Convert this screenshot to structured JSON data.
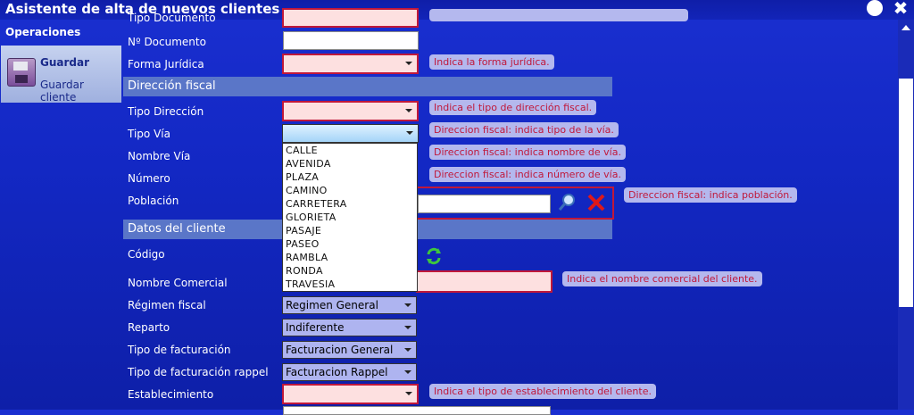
{
  "window": {
    "title": "Asistente de alta de nuevos clientes"
  },
  "left_panel": {
    "heading": "Operaciones",
    "save": {
      "title": "Guardar",
      "subtitle": "Guardar cliente"
    }
  },
  "form": {
    "labels": {
      "tipo_documento": "Tipo Documento",
      "n_documento": "Nº Documento",
      "forma_juridica": "Forma Jurídica",
      "tipo_direccion": "Tipo Dirección",
      "tipo_via": "Tipo Vía",
      "nombre_via": "Nombre Vía",
      "numero": "Número",
      "poblacion": "Población",
      "codigo": "Código",
      "nombre_comercial": "Nombre Comercial",
      "regimen_fiscal": "Régimen fiscal",
      "reparto": "Reparto",
      "tipo_facturacion": "Tipo de facturación",
      "tipo_facturacion_rappel": "Tipo de facturación rappel",
      "establecimiento": "Establecimiento"
    },
    "sections": {
      "direccion_fiscal": "Dirección fiscal",
      "datos_cliente": "Datos del cliente"
    },
    "selects": {
      "regimen_fiscal": "Regimen General",
      "reparto": "Indiferente",
      "tipo_facturacion": "Facturacion General",
      "tipo_facturacion_rappel": "Facturacion Rappel"
    },
    "tooltips": {
      "forma_juridica": "Indica la forma jurídica.",
      "tipo_direccion": "Indica el tipo de dirección fiscal.",
      "tipo_via": "Direccion fiscal: indica tipo de la vía.",
      "nombre_via": "Direccion fiscal: indica nombre de vía.",
      "numero": "Direccion fiscal: indica número de vía.",
      "poblacion": "Direccion fiscal: indica población.",
      "nombre_comercial": "Indica el nombre comercial del cliente.",
      "establecimiento": "Indica el tipo de establecimiento del cliente."
    },
    "via_options": [
      "CALLE",
      "AVENIDA",
      "PLAZA",
      "CAMINO",
      "CARRETERA",
      "GLORIETA",
      "PASAJE",
      "PASEO",
      "RAMBLA",
      "RONDA",
      "TRAVESIA"
    ]
  },
  "colors": {
    "background": "#1328c4",
    "required_border": "#c0183a",
    "required_fill": "#fde0e0",
    "tooltip_bg": "#b4b8ee"
  },
  "icons": [
    "floppy-disk-icon",
    "search-icon",
    "clear-icon",
    "refresh-icon",
    "close-icon"
  ]
}
